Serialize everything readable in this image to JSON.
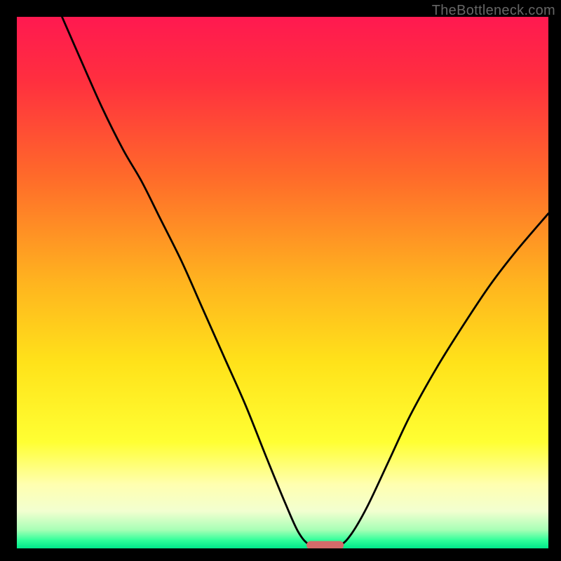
{
  "watermark": "TheBottleneck.com",
  "chart_data": {
    "type": "line",
    "title": "",
    "xlabel": "",
    "ylabel": "",
    "xlim": [
      0,
      1
    ],
    "ylim": [
      0,
      1
    ],
    "gradient_stops": [
      {
        "offset": 0.0,
        "color": "#ff1950"
      },
      {
        "offset": 0.12,
        "color": "#ff2f3f"
      },
      {
        "offset": 0.3,
        "color": "#ff6a2a"
      },
      {
        "offset": 0.5,
        "color": "#ffb41f"
      },
      {
        "offset": 0.65,
        "color": "#ffe21a"
      },
      {
        "offset": 0.8,
        "color": "#ffff33"
      },
      {
        "offset": 0.88,
        "color": "#ffffb0"
      },
      {
        "offset": 0.93,
        "color": "#f2ffd0"
      },
      {
        "offset": 0.965,
        "color": "#a8ffb6"
      },
      {
        "offset": 0.985,
        "color": "#2fff9a"
      },
      {
        "offset": 1.0,
        "color": "#00e88a"
      }
    ],
    "series": [
      {
        "name": "bottleneck-curve",
        "color": "#000000",
        "width": 2.8,
        "points": [
          {
            "x": 0.085,
            "y": 1.0
          },
          {
            "x": 0.12,
            "y": 0.92
          },
          {
            "x": 0.16,
            "y": 0.83
          },
          {
            "x": 0.2,
            "y": 0.75
          },
          {
            "x": 0.235,
            "y": 0.69
          },
          {
            "x": 0.27,
            "y": 0.62
          },
          {
            "x": 0.31,
            "y": 0.54
          },
          {
            "x": 0.35,
            "y": 0.45
          },
          {
            "x": 0.39,
            "y": 0.36
          },
          {
            "x": 0.43,
            "y": 0.27
          },
          {
            "x": 0.47,
            "y": 0.17
          },
          {
            "x": 0.505,
            "y": 0.085
          },
          {
            "x": 0.53,
            "y": 0.03
          },
          {
            "x": 0.552,
            "y": 0.006
          },
          {
            "x": 0.58,
            "y": 0.004
          },
          {
            "x": 0.608,
            "y": 0.006
          },
          {
            "x": 0.63,
            "y": 0.028
          },
          {
            "x": 0.66,
            "y": 0.08
          },
          {
            "x": 0.7,
            "y": 0.165
          },
          {
            "x": 0.74,
            "y": 0.25
          },
          {
            "x": 0.79,
            "y": 0.34
          },
          {
            "x": 0.84,
            "y": 0.42
          },
          {
            "x": 0.89,
            "y": 0.495
          },
          {
            "x": 0.94,
            "y": 0.56
          },
          {
            "x": 1.0,
            "y": 0.63
          }
        ]
      }
    ],
    "marker": {
      "name": "optimal-bar",
      "x_start": 0.545,
      "x_end": 0.615,
      "y": 0.006,
      "color": "#d46a6a",
      "thickness": 12
    }
  }
}
